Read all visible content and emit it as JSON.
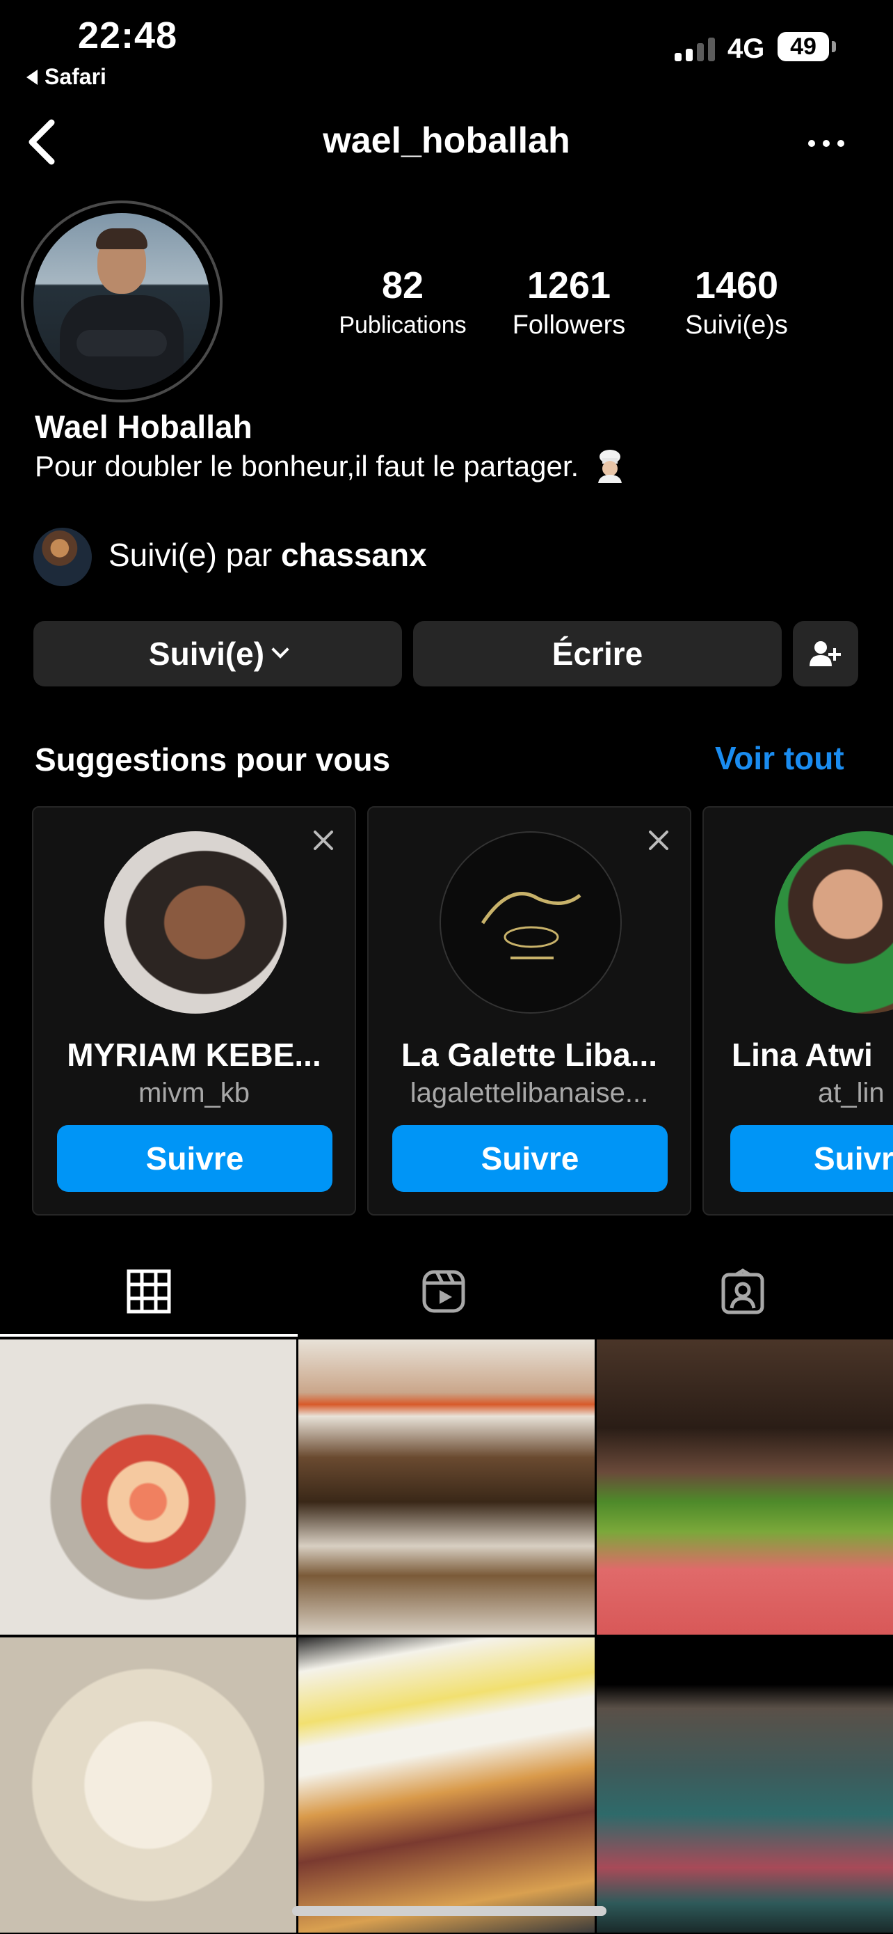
{
  "status_bar": {
    "time": "22:48",
    "back_app": "Safari",
    "network": "4G",
    "battery": "49"
  },
  "nav": {
    "username": "wael_hoballah",
    "back_icon": "chevron-left-icon",
    "more_icon": "more-horizontal-icon"
  },
  "profile": {
    "stats": [
      {
        "value": "82",
        "label": "Publications"
      },
      {
        "value": "1261",
        "label": "Followers"
      },
      {
        "value": "1460",
        "label": "Suivi(e)s"
      }
    ],
    "name": "Wael Hoballah",
    "bio": "Pour doubler le bonheur,il faut le partager.",
    "followed_by_prefix": "Suivi(e) par ",
    "followed_by_user": "chassanx"
  },
  "actions": {
    "following": "Suivi(e)",
    "message": "Écrire",
    "add_user_icon": "add-person-icon"
  },
  "suggestions": {
    "title": "Suggestions pour vous",
    "see_all": "Voir tout",
    "cards": [
      {
        "name": "MYRIAM KEBE...",
        "handle": "mivm_kb",
        "button": "Suivre"
      },
      {
        "name": "La Galette Liba...",
        "handle": "lagalettelibanaise...",
        "button": "Suivre"
      },
      {
        "name": "Lina Atwi",
        "handle": "at_lin",
        "button": "Suivr"
      }
    ]
  },
  "tabs": [
    "grid-icon",
    "reels-icon",
    "tagged-icon"
  ],
  "colors": {
    "accent": "#0095f6",
    "link": "#1a8cf0",
    "button_bg": "#262626",
    "background": "#000000"
  }
}
